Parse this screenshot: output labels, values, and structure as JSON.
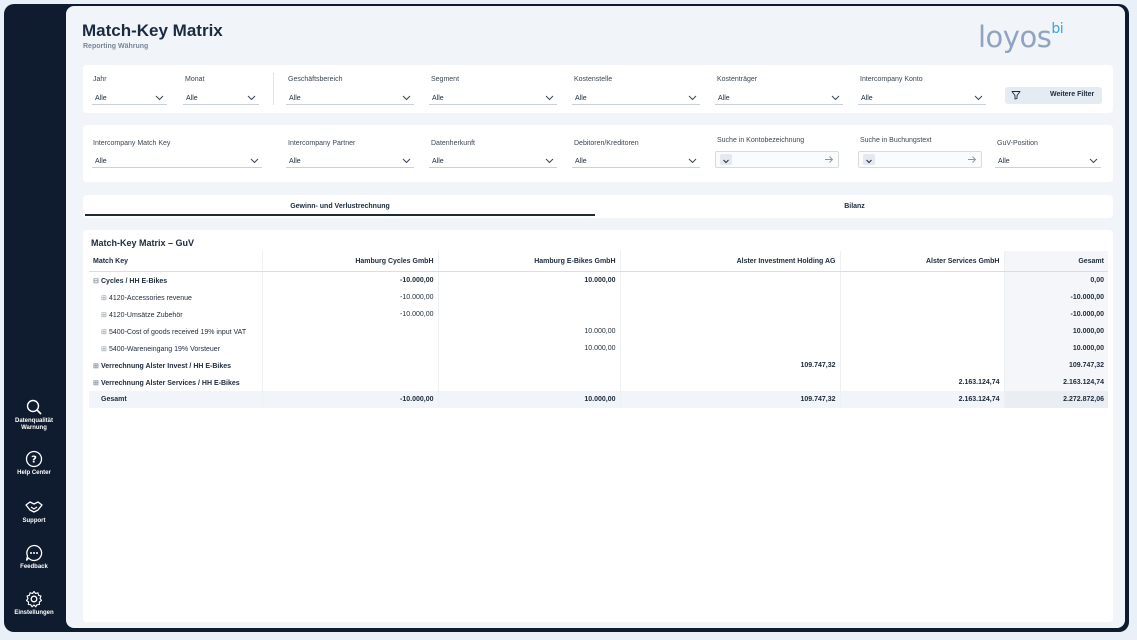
{
  "nav": [
    {
      "label": "Datenqualität Warnung",
      "icon": "search-icon"
    },
    {
      "label": "Help Center",
      "icon": "question-icon"
    },
    {
      "label": "Support",
      "icon": "handshake-icon"
    },
    {
      "label": "Feedback",
      "icon": "chat-icon"
    },
    {
      "label": "Einstellungen",
      "icon": "gear-icon"
    }
  ],
  "header": {
    "title": "Match-Key Matrix",
    "subtitle": "Reporting Währung",
    "logo_text": "loyos",
    "logo_sup": "bi"
  },
  "filters1": {
    "jahr": {
      "label": "Jahr",
      "value": "Alle"
    },
    "monat": {
      "label": "Monat",
      "value": "Alle"
    },
    "geschaeftsbereich": {
      "label": "Geschäftsbereich",
      "value": "Alle"
    },
    "segment": {
      "label": "Segment",
      "value": "Alle"
    },
    "kostenstelle": {
      "label": "Kostenstelle",
      "value": "Alle"
    },
    "kostentraeger": {
      "label": "Kostenträger",
      "value": "Alle"
    },
    "ic_konto": {
      "label": "Intercompany Konto",
      "value": "Alle"
    },
    "more_filters": "Weitere Filter"
  },
  "filters2": {
    "ic_match_key": {
      "label": "Intercompany Match Key",
      "value": "Alle"
    },
    "ic_partner": {
      "label": "Intercompany Partner",
      "value": "Alle"
    },
    "datenherkunft": {
      "label": "Datenherkunft",
      "value": "Alle"
    },
    "debitoren": {
      "label": "Debitoren/Kreditoren",
      "value": "Alle"
    },
    "suche_konto": {
      "label": "Suche in Kontobezeichnung"
    },
    "suche_buchung": {
      "label": "Suche in Buchungstext"
    },
    "guv_position": {
      "label": "GuV-Position",
      "value": "Alle"
    }
  },
  "tabs": {
    "guv": "Gewinn- und Verlustrechnung",
    "bilanz": "Bilanz"
  },
  "matrix": {
    "title": "Match-Key Matrix – GuV",
    "columns": [
      "Match Key",
      "Hamburg Cycles GmbH",
      "Hamburg E-Bikes GmbH",
      "Alster Investment Holding AG",
      "Alster Services GmbH",
      "Gesamt"
    ],
    "rows": [
      {
        "expander": "⊟",
        "label": "Cycles / HH E-Bikes",
        "c1": "-10.000,00",
        "c2": "10.000,00",
        "c3": "",
        "c4": "",
        "total": "0,00"
      },
      {
        "expander": "⊞",
        "label": "4120-Accessories revenue",
        "c1": "-10.000,00",
        "c2": "",
        "c3": "",
        "c4": "",
        "total": "-10.000,00"
      },
      {
        "expander": "⊞",
        "label": "4120-Umsätze Zubehör",
        "c1": "-10.000,00",
        "c2": "",
        "c3": "",
        "c4": "",
        "total": "-10.000,00"
      },
      {
        "expander": "⊞",
        "label": "5400-Cost of goods received 19% input VAT",
        "c1": "",
        "c2": "10.000,00",
        "c3": "",
        "c4": "",
        "total": "10.000,00"
      },
      {
        "expander": "⊞",
        "label": "5400-Wareneingang 19% Vorsteuer",
        "c1": "",
        "c2": "10.000,00",
        "c3": "",
        "c4": "",
        "total": "10.000,00"
      },
      {
        "expander": "⊞",
        "label": "Verrechnung Alster Invest / HH E-Bikes",
        "c1": "",
        "c2": "",
        "c3": "109.747,32",
        "c4": "",
        "total": "109.747,32"
      },
      {
        "expander": "⊞",
        "label": "Verrechnung Alster Services / HH E-Bikes",
        "c1": "",
        "c2": "",
        "c3": "",
        "c4": "2.163.124,74",
        "total": "2.163.124,74"
      }
    ],
    "total": {
      "label": "Gesamt",
      "c1": "-10.000,00",
      "c2": "10.000,00",
      "c3": "109.747,32",
      "c4": "2.163.124,74",
      "total": "2.272.872,06"
    }
  }
}
